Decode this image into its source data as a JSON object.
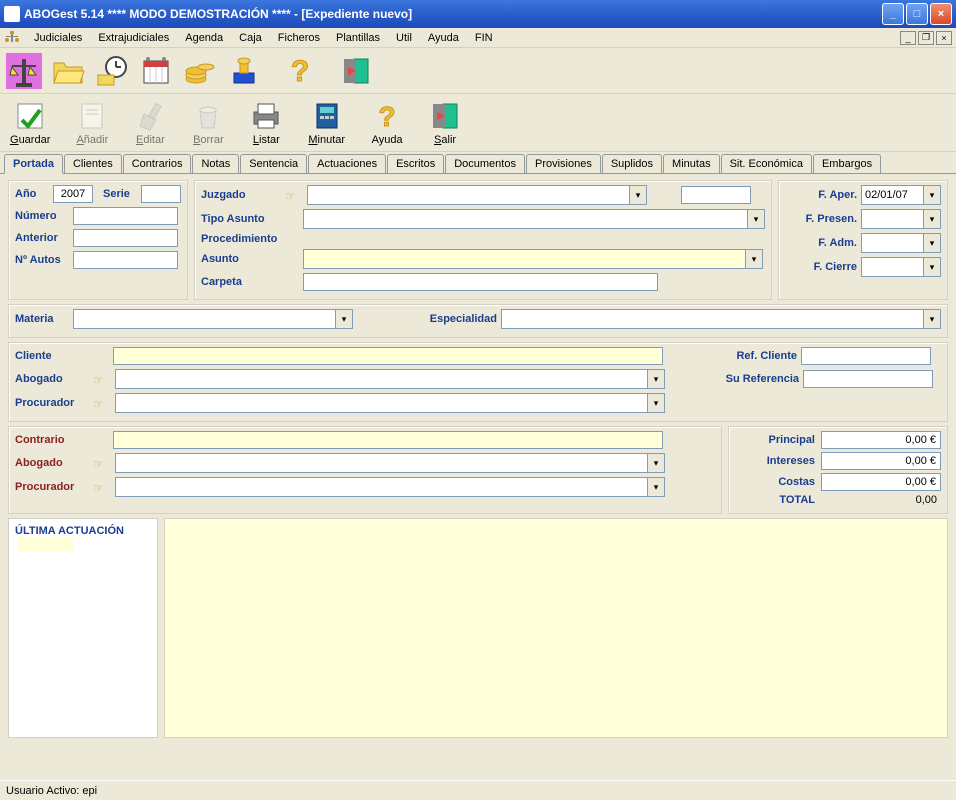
{
  "window": {
    "title": "ABOGest 5.14 **** MODO DEMOSTRACIÓN ****  - [Expediente nuevo]"
  },
  "menu": {
    "items": [
      "Judiciales",
      "Extrajudiciales",
      "Agenda",
      "Caja",
      "Ficheros",
      "Plantillas",
      "Util",
      "Ayuda",
      "FIN"
    ]
  },
  "toolbar1_icons": [
    "balance",
    "folder-open",
    "clock",
    "calendar",
    "coins",
    "stamp",
    "help",
    "exit"
  ],
  "toolbar2": {
    "guardar": "Guardar",
    "anadir": "Añadir",
    "editar": "Editar",
    "borrar": "Borrar",
    "listar": "Listar",
    "minutar": "Minutar",
    "ayuda": "Ayuda",
    "salir": "Salir"
  },
  "tabs": [
    "Portada",
    "Clientes",
    "Contrarios",
    "Notas",
    "Sentencia",
    "Actuaciones",
    "Escritos",
    "Documentos",
    "Provisiones",
    "Suplidos",
    "Minutas",
    "Sit. Económica",
    "Embargos"
  ],
  "form": {
    "ano_label": "Año",
    "ano_value": "2007",
    "serie_label": "Serie",
    "serie_value": "",
    "numero_label": "Número",
    "numero_value": "",
    "anterior_label": "Anterior",
    "anterior_value": "",
    "autos_label": "Nº Autos",
    "autos_value": "",
    "juzgado_label": "Juzgado",
    "tipo_asunto_label": "Tipo Asunto",
    "procedimiento_label": "Procedimiento",
    "asunto_label": "Asunto",
    "carpeta_label": "Carpeta",
    "materia_label": "Materia",
    "especialidad_label": "Especialidad",
    "cliente_label": "Cliente",
    "abogado_label": "Abogado",
    "procurador_label": "Procurador",
    "contrario_label": "Contrario",
    "ref_cliente_label": "Ref. Cliente",
    "su_referencia_label": "Su Referencia",
    "f_aper_label": "F. Aper.",
    "f_aper_value": "02/01/07",
    "f_presen_label": "F. Presen.",
    "f_adm_label": "F. Adm.",
    "f_cierre_label": "F. Cierre",
    "principal_label": "Principal",
    "principal_value": "0,00 €",
    "intereses_label": "Intereses",
    "intereses_value": "0,00 €",
    "costas_label": "Costas",
    "costas_value": "0,00 €",
    "total_label": "TOTAL",
    "total_value": "0,00",
    "ultima_actuacion_label": "ÚLTIMA ACTUACIÓN"
  },
  "statusbar": "Usuario Activo: epi"
}
